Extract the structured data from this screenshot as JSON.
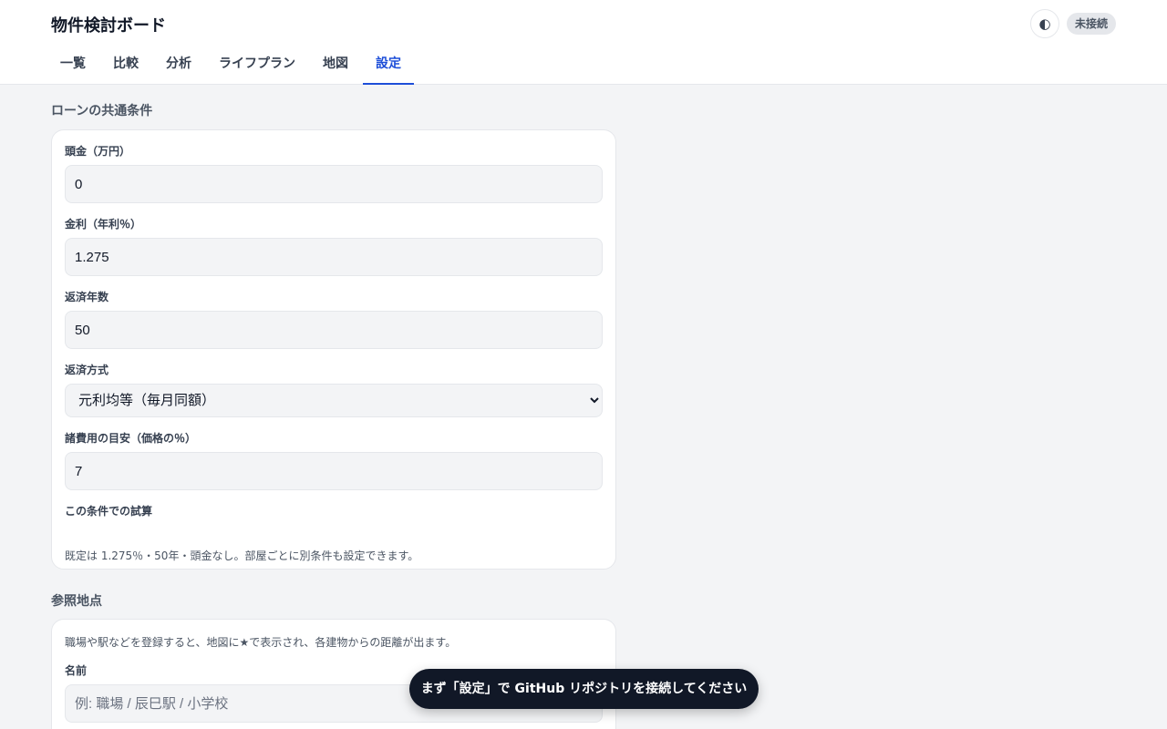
{
  "header": {
    "title": "物件検討ボード",
    "theme_toggle_glyph": "◐",
    "status": "未接続"
  },
  "tabs": [
    {
      "label": "一覧"
    },
    {
      "label": "比較"
    },
    {
      "label": "分析"
    },
    {
      "label": "ライフプラン"
    },
    {
      "label": "地図"
    },
    {
      "label": "設定",
      "active": true
    }
  ],
  "loan": {
    "section_title": "ローンの共通条件",
    "down_payment": {
      "label": "頭金（万円）",
      "value": "0"
    },
    "interest_rate": {
      "label": "金利（年利％）",
      "value": "1.275"
    },
    "years": {
      "label": "返済年数",
      "value": "50"
    },
    "method": {
      "label": "返済方式",
      "selected": "元利均等（毎月同額）"
    },
    "expenses": {
      "label": "諸費用の目安（価格の％）",
      "value": "7"
    },
    "simulation_label": "この条件での試算",
    "note": "既定は 1.275％・50年・頭金なし。部屋ごとに別条件も設定できます。"
  },
  "reference": {
    "section_title": "参照地点",
    "description": "職場や駅などを登録すると、地図に★で表示され、各建物からの距離が出ます。",
    "name_label": "名前",
    "name_placeholder": "例: 職場 / 辰巳駅 / 小学校"
  },
  "toast": "まず「設定」で GitHub リポジトリを接続してください",
  "colors": {
    "accent": "#1d4ed8",
    "background": "#f3f4f6",
    "toast_bg": "#111827"
  }
}
